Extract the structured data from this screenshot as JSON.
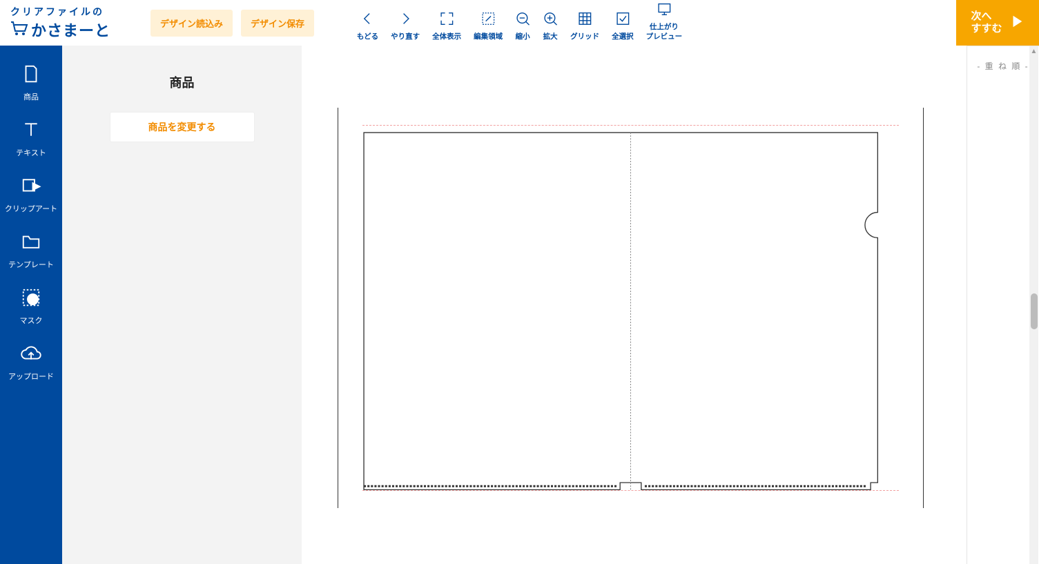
{
  "logo": {
    "top": "クリアファイルの",
    "main": "かさまーと"
  },
  "headerButtons": {
    "load": "デザイン読込み",
    "save": "デザイン保存"
  },
  "toolbar": {
    "undo": "もどる",
    "redo": "やり直す",
    "fitall": "全体表示",
    "editarea": "編集領域",
    "zoomout": "縮小",
    "zoomin": "拡大",
    "grid": "グリッド",
    "selectall": "全選択",
    "preview1": "仕上がり",
    "preview2": "プレビュー"
  },
  "nextButton": {
    "line1": "次へ",
    "line2": "すすむ"
  },
  "leftNav": {
    "product": "商品",
    "text": "テキスト",
    "clipart": "クリップアート",
    "template": "テンプレート",
    "mask": "マスク",
    "upload": "アップロード"
  },
  "sidePanel": {
    "title": "商品",
    "changeBtn": "商品を変更する"
  },
  "layerPanel": {
    "title": "- 重 ね 順 -"
  }
}
